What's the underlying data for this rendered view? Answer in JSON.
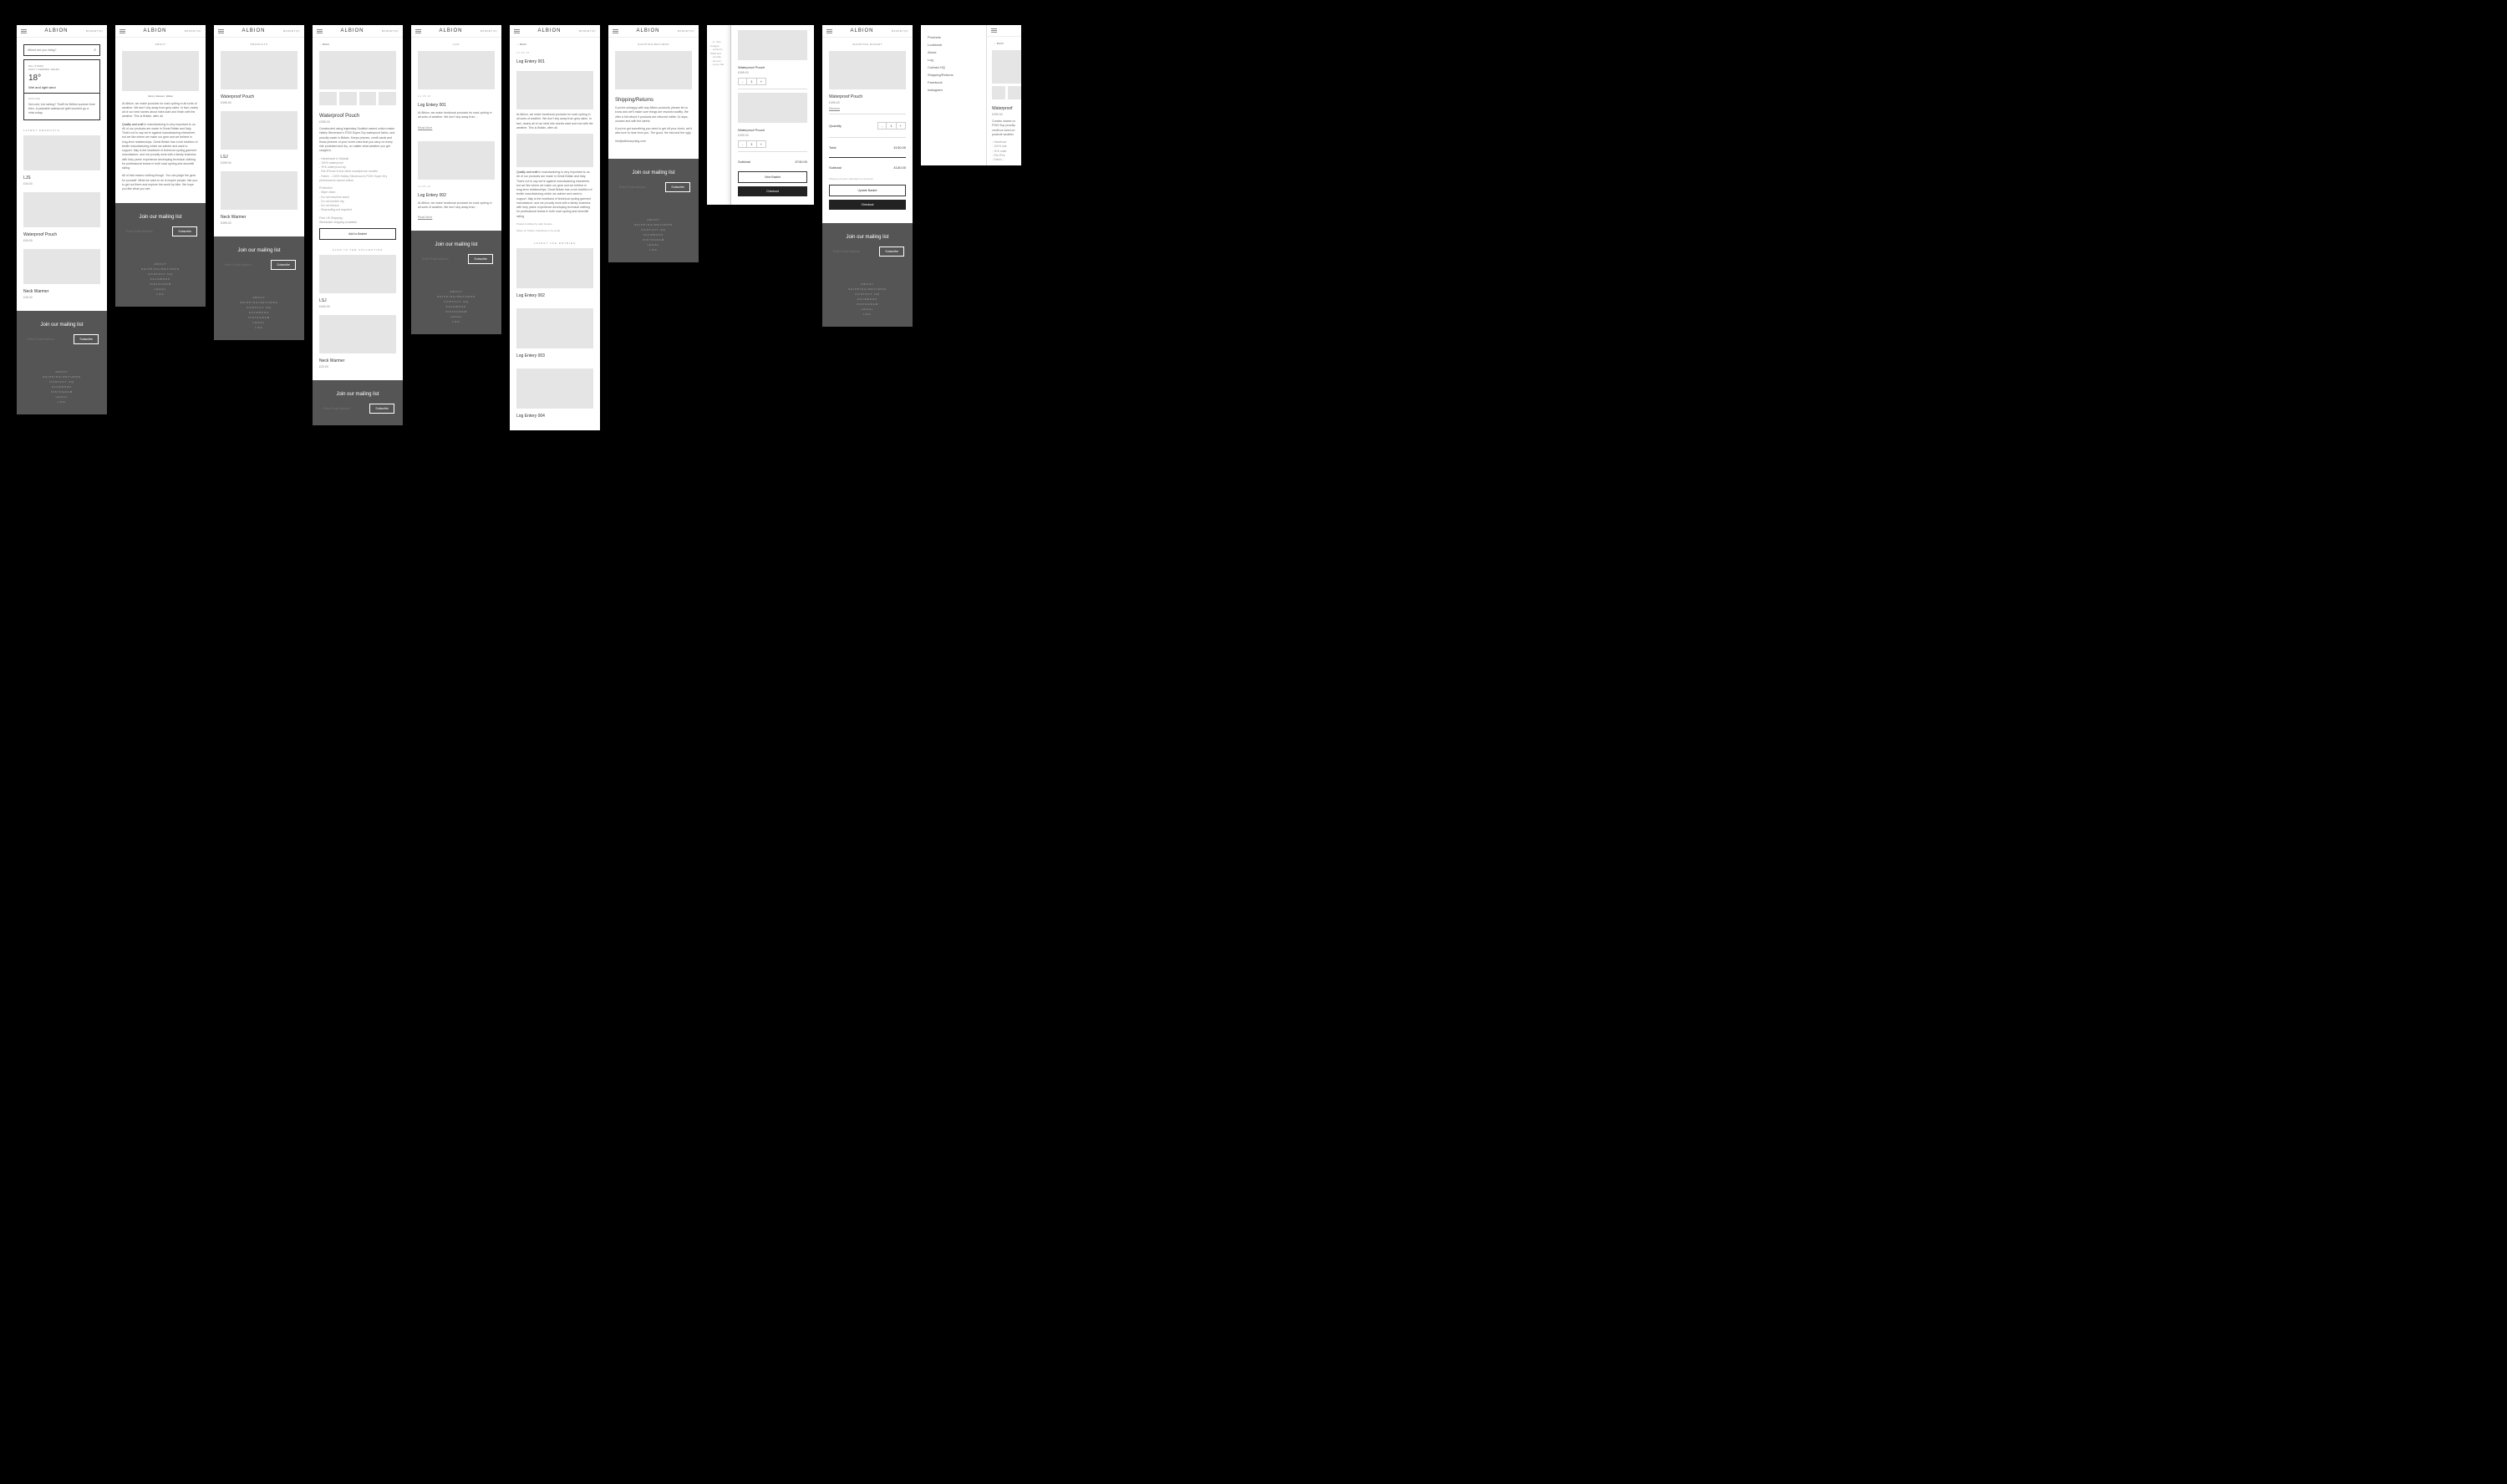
{
  "common": {
    "brand": "ALBION",
    "basket": "BASKET(0)",
    "mailing_title": "Join our mailing list",
    "email_placeholder": "Enter Email Address",
    "subscribe": "Subscribe",
    "footer": [
      "ABOUT",
      "SHIPPING/RETURNS",
      "CONTACT HQ",
      "FACEBOOK",
      "INSTAGRAM",
      "LEGAL",
      "LOG"
    ]
  },
  "s1": {
    "search_placeholder": "Where are you riding?",
    "meta1": "Mon, 8:30AM",
    "meta2": "NANT Y DERWEN, WALES",
    "temp": "18°",
    "cond": "Wet and light wind",
    "adv_label": "ADVICE",
    "adv_text": "Not cold, but raining? That'll be British summer time then. A packable waterproof gilet wouldn't go a miss today.",
    "latest": "LATEST PRODUCTS",
    "p1_name": "LJS",
    "p1_price": "£40.00",
    "p2_name": "Waterproof Pouch",
    "p2_price": "£40.00",
    "p3_name": "Neck Warmer",
    "p3_price": "£40.00"
  },
  "s2": {
    "crumb": "ABOUT",
    "caption": "Nant y Derwen, Wales",
    "para1": "At Albion, we make products for road cycling in all sorts of weather. We don't shy away from grey skies. In fact, nearly all of our best stories about rides start and finish with the weather. This is Britain, after all.",
    "para2_lead": "Quality and craft",
    "para2": " in manufacturing is very important to us. All of our products are made in Great Britain and Italy. That's not to say we're against manufacturing elsewhere, but we like where we make our gear and we believe in long-term relationships. Great Britain has a rich tradition of textile manufacturing which we admire and want to support. Italy is the heartland of technical cycling garment manufacture, and we proudly work with a family business with forty years' experience developing technical clothing for professional teams in both road cycling and downhill skiing.",
    "para3": "All of that means nothing though. You can judge the gear for yourself. What we want to do is inspire people, like you, to get out there and explore the world by bike. We hope you like what you see."
  },
  "s3": {
    "crumb": "PRODUCTS",
    "p1_name": "Waterproof Pouch",
    "p1_price": "£395.00",
    "p2_name": "LSJ",
    "p2_price": "£395.00",
    "p3_name": "Neck Warmer",
    "p3_price": "£395.00"
  },
  "s4": {
    "back": "BACK",
    "name": "Waterproof Pouch",
    "price": "£395.00",
    "desc": "Constructed using legendary Scottish waxed cotton maker Halley Stevenson's P200 Super Dry waterproof fabric, and proudly made in Britain. Keeps phones, credit cards and those pictures of your loved ones that you carry on every ride protected and dry, no matter what weather you get caught in.",
    "bul1": "- Handmade in Walsall",
    "bul2": "- 100% waterproof",
    "bul3": "- YKK waterproof zip",
    "bul4": "- Fits iPhone 6 and other smartphone models",
    "bul5": "- Fabric – 100% Halley Stevenson's P200 Super Dry performance waxed cotton",
    "care_h": "Protection",
    "c1": "- Wipe clean",
    "c2": "- Do not machine wash",
    "c3": "- Do not tumble dry",
    "c4": "- Do not bleach",
    "c5": "- Reproofing not required",
    "ship1": "Free UK Shipping.",
    "ship2": "Worldwide shipping available.",
    "add": "Add to Basket",
    "also": "ALSO IN THE COLLECTION",
    "r1_name": "LSJ",
    "r1_price": "£400.00",
    "r2_name": "Neck Warmer",
    "r2_price": "£20.00"
  },
  "s5": {
    "crumb": "LOG",
    "d1": "14.05.16",
    "t1": "Log Entery 001",
    "ex1": "At Albion, we make functional products for road cycling in all sorts of weather. We don't shy away from…",
    "more": "Read More",
    "d2": "14.05.16",
    "t2": "Log Entery 002",
    "ex2": "At Albion, we make functional products for road cycling in all sorts of weather. We don't shy away from…"
  },
  "s6": {
    "back": "BACK",
    "d1": "14.05.16",
    "t1": "Log Entery 001",
    "para1": "At Albion, we make functional products for road cycling in all sorts of weather. We don't shy away from grey skies. In fact, nearly all of our best ride stories start and end with the weather. This is Britain, after all.",
    "para2_lead": "Quality and craft",
    "para2": " in manufacturing is very important to us. All of our products are made in Great Britain and Italy. That's not to say we're against manufacturing elsewhere, but we like where we make our gear and we believe in long-term relationships. Great Britain has a rich tradition of textile manufacturing which we admire and want to support. Italy is the heartland of technical cycling garment manufacture, and we proudly work with a family business with forty years' experience developing technical clothing for professional teams in both road cycling and downhill skiing.",
    "posted": "Posted to Rides by Jack Hooker",
    "share": "Share on Twitter, Facebook or by email",
    "latest": "LATEST LOG ENTRIES",
    "e2": "Log Entery 002",
    "e3": "Log Entery 003",
    "e4": "Log Entery 004"
  },
  "s7": {
    "crumb": "SHIPPING/RETURNS",
    "title": "Shipping/Returns",
    "p1": "If you're unhappy with any Albion products, please let us know and we'll make sure things are resolved swiftly. We offer a full refund if products are returned within 14 days, unused and with the labels.",
    "p2": "If you've got something you need to get off your chest, we'd also love to hear from you. The good, the bad and the ugly.",
    "email": "info@albioncycling.com"
  },
  "s8": {
    "name": "Waterproof Pouch",
    "price": "£395.00",
    "qty": "1",
    "frag": "…in. Just imagine.\n…venson's P200 and\n…proudly\n…off your\n…every ride",
    "subtotal_l": "Subtotal",
    "subtotal_v": "£740.00",
    "view": "View Basket",
    "checkout": "Checkout"
  },
  "s9": {
    "crumb": "SHOPPING BASKET",
    "name": "Waterproof Pouch",
    "price": "£395.00",
    "remove": "Remove",
    "qty_l": "Quantity",
    "qty": "1",
    "total_l": "Total",
    "total_v": "£130.00",
    "subtotal_l": "Subtotal",
    "subtotal_v": "£130.00",
    "tax": "Shipping & taxes calculated at checkout",
    "update": "Update Basket",
    "checkout": "Checkout"
  },
  "s10": {
    "items": [
      "Products",
      "Lookbook",
      "About",
      "Log",
      "Contact HQ",
      "Shipping/Returns",
      "Facebook",
      "Instagram"
    ],
    "back": "BACK",
    "name": "Waterproof",
    "price": "£395.00",
    "desc": "Constru waxed co P200 Sup proudly credit ca loved on protecte weather",
    "b1": "- Handmad",
    "b2": "- 100% wat",
    "b3": "- YKK wate",
    "b4": "- Fits iPho",
    "b5": "- Fabric –"
  }
}
